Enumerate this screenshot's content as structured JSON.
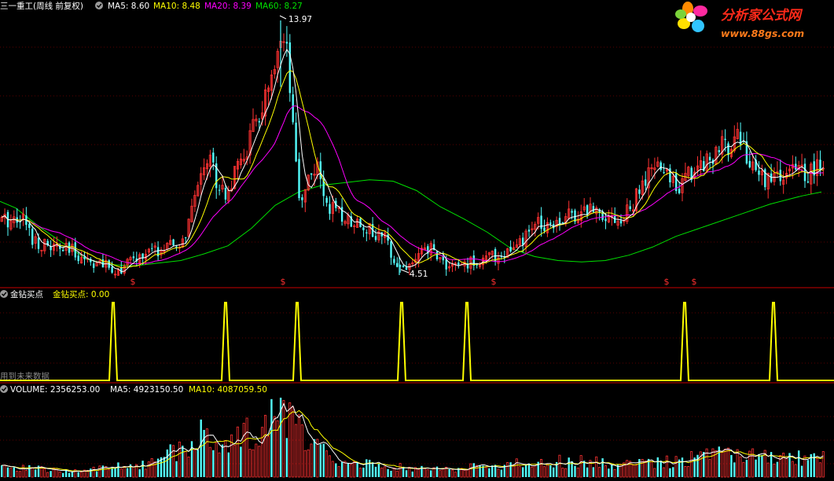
{
  "main_header": {
    "title": "三一重工(周线 前复权)",
    "ma5": "MA5: 8.60",
    "ma10": "MA10: 8.48",
    "ma20": "MA20: 8.39",
    "ma60": "MA60: 8.27"
  },
  "annotations": {
    "high_label": "13.97",
    "low_label": "4.51"
  },
  "signal_marker": "$",
  "indicator_header": {
    "name": "金钻买点",
    "value_label": "金钻买点: 0.00"
  },
  "indicator_note": "用到未来数据",
  "volume_header": {
    "volume": "VOLUME: 2356253.00",
    "ma5": "MA5: 4923150.50",
    "ma10": "MA10: 4087059.50"
  },
  "logo": {
    "title": "分析家公式网",
    "url": "www.88gs.com"
  },
  "colors": {
    "up": "#ff3232",
    "down": "#54fcfc",
    "ma5": "#ffffff",
    "ma10": "#ffff00",
    "ma20": "#ff00ff",
    "ma60": "#00e000",
    "signal": "#ffff00",
    "divider": "#a00000"
  },
  "icons": [
    "collapse-circle-icon",
    "flower-logo-icon"
  ],
  "chart_data": [
    {
      "type": "candlestick",
      "unit": "price",
      "ylim": [
        4.0,
        14.5
      ],
      "price_labels": {
        "high": 13.97,
        "low": 4.51
      },
      "ma60_path": [
        [
          0,
          7.25
        ],
        [
          20,
          7.0
        ],
        [
          50,
          6.3
        ],
        [
          80,
          5.7
        ],
        [
          110,
          5.1
        ],
        [
          140,
          4.9
        ],
        [
          170,
          4.85
        ],
        [
          200,
          4.95
        ],
        [
          230,
          5.05
        ],
        [
          260,
          5.3
        ],
        [
          290,
          5.6
        ],
        [
          320,
          6.25
        ],
        [
          350,
          7.1
        ],
        [
          380,
          7.6
        ],
        [
          410,
          7.85
        ],
        [
          440,
          7.95
        ],
        [
          470,
          8.05
        ],
        [
          500,
          8.0
        ],
        [
          530,
          7.65
        ],
        [
          560,
          7.05
        ],
        [
          590,
          6.6
        ],
        [
          620,
          6.1
        ],
        [
          650,
          5.5
        ],
        [
          680,
          5.2
        ],
        [
          710,
          5.05
        ],
        [
          740,
          5.0
        ],
        [
          770,
          5.05
        ],
        [
          800,
          5.25
        ],
        [
          830,
          5.55
        ],
        [
          860,
          5.95
        ],
        [
          900,
          6.35
        ],
        [
          940,
          6.75
        ],
        [
          980,
          7.15
        ],
        [
          1020,
          7.45
        ],
        [
          1045,
          7.6
        ]
      ],
      "candle_keys": [
        [
          0,
          6.5
        ],
        [
          15,
          6.6
        ],
        [
          25,
          6.8
        ],
        [
          40,
          5.9
        ],
        [
          55,
          5.6
        ],
        [
          70,
          5.5
        ],
        [
          90,
          5.4
        ],
        [
          110,
          5.1
        ],
        [
          130,
          4.85
        ],
        [
          150,
          4.7
        ],
        [
          165,
          5.0
        ],
        [
          185,
          5.3
        ],
        [
          210,
          5.5
        ],
        [
          230,
          5.6
        ],
        [
          245,
          7.0
        ],
        [
          255,
          8.6
        ],
        [
          265,
          9.0
        ],
        [
          272,
          8.2
        ],
        [
          285,
          7.6
        ],
        [
          295,
          8.0
        ],
        [
          310,
          9.0
        ],
        [
          325,
          10.2
        ],
        [
          340,
          11.2
        ],
        [
          350,
          12.1
        ],
        [
          358,
          13.0
        ],
        [
          365,
          12.4
        ],
        [
          372,
          9.5
        ],
        [
          380,
          7.2
        ],
        [
          392,
          8.2
        ],
        [
          400,
          8.6
        ],
        [
          412,
          7.4
        ],
        [
          425,
          6.8
        ],
        [
          440,
          6.6
        ],
        [
          458,
          6.5
        ],
        [
          475,
          6.0
        ],
        [
          490,
          5.8
        ],
        [
          505,
          4.9
        ],
        [
          515,
          4.75
        ],
        [
          530,
          5.2
        ],
        [
          548,
          5.5
        ],
        [
          565,
          4.9
        ],
        [
          580,
          4.8
        ],
        [
          600,
          5.0
        ],
        [
          620,
          5.15
        ],
        [
          640,
          5.3
        ],
        [
          660,
          5.6
        ],
        [
          680,
          6.4
        ],
        [
          700,
          6.5
        ],
        [
          720,
          6.7
        ],
        [
          740,
          6.9
        ],
        [
          760,
          7.0
        ],
        [
          775,
          6.7
        ],
        [
          790,
          6.5
        ],
        [
          805,
          7.2
        ],
        [
          820,
          8.0
        ],
        [
          835,
          8.6
        ],
        [
          850,
          8.1
        ],
        [
          865,
          7.9
        ],
        [
          880,
          8.4
        ],
        [
          895,
          8.8
        ],
        [
          910,
          9.0
        ],
        [
          925,
          9.4
        ],
        [
          935,
          9.9
        ],
        [
          945,
          9.3
        ],
        [
          955,
          8.4
        ],
        [
          965,
          8.2
        ],
        [
          980,
          8.1
        ],
        [
          1000,
          8.2
        ],
        [
          1015,
          8.4
        ],
        [
          1030,
          8.3
        ],
        [
          1045,
          8.6
        ]
      ],
      "ma_lines": [
        {
          "name": "MA5",
          "value": 8.6,
          "last_label": "MA5: 8.60"
        },
        {
          "name": "MA10",
          "value": 8.48,
          "last_label": "MA10: 8.48"
        },
        {
          "name": "MA20",
          "value": 8.39,
          "last_label": "MA20: 8.39"
        },
        {
          "name": "MA60",
          "value": 8.27,
          "last_label": "MA60: 8.27"
        }
      ]
    },
    {
      "type": "line",
      "name": "金钻买点",
      "ylim": [
        0,
        1
      ],
      "spikes_x": [
        144,
        287,
        378,
        511,
        594,
        871,
        984
      ]
    },
    {
      "type": "bar",
      "name": "VOLUME",
      "last": 2356253.0,
      "ma5": 4923150.5,
      "ma10": 4087059.5,
      "volume_keys": [
        [
          0,
          0.12
        ],
        [
          100,
          0.08
        ],
        [
          200,
          0.18
        ],
        [
          240,
          0.45
        ],
        [
          255,
          0.6
        ],
        [
          275,
          0.35
        ],
        [
          300,
          0.45
        ],
        [
          325,
          0.62
        ],
        [
          340,
          0.72
        ],
        [
          352,
          0.92
        ],
        [
          362,
          0.78
        ],
        [
          375,
          0.62
        ],
        [
          395,
          0.5
        ],
        [
          410,
          0.3
        ],
        [
          430,
          0.22
        ],
        [
          460,
          0.18
        ],
        [
          500,
          0.14
        ],
        [
          540,
          0.1
        ],
        [
          600,
          0.12
        ],
        [
          650,
          0.16
        ],
        [
          700,
          0.2
        ],
        [
          760,
          0.18
        ],
        [
          800,
          0.16
        ],
        [
          850,
          0.2
        ],
        [
          900,
          0.26
        ],
        [
          940,
          0.28
        ],
        [
          1000,
          0.22
        ],
        [
          1045,
          0.26
        ]
      ]
    }
  ]
}
